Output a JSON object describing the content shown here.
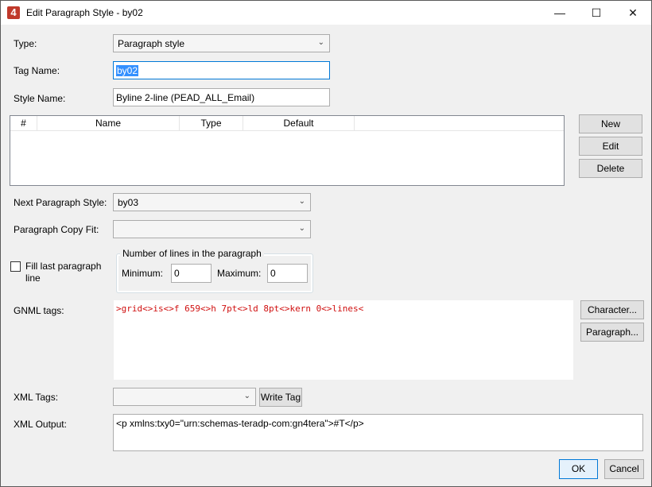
{
  "window": {
    "app_icon": "4",
    "title": "Edit Paragraph Style - by02",
    "minimize_glyph": "—",
    "maximize_glyph": "☐",
    "close_glyph": "✕"
  },
  "type": {
    "label": "Type:",
    "value": "Paragraph style"
  },
  "tag_name": {
    "label": "Tag Name:",
    "value": "by02"
  },
  "style_name": {
    "label": "Style Name:",
    "value": "Byline 2-line (PEAD_ALL_Email)"
  },
  "table": {
    "columns": [
      "#",
      "Name",
      "Type",
      "Default"
    ],
    "rows": []
  },
  "side_buttons": {
    "new": "New",
    "edit": "Edit",
    "delete": "Delete"
  },
  "next_style": {
    "label": "Next Paragraph Style:",
    "value": "by03"
  },
  "copy_fit": {
    "label": "Paragraph Copy Fit:",
    "value": ""
  },
  "fill_last": {
    "label_line1": "Fill last paragraph",
    "label_line2": "line",
    "checked": false
  },
  "lines_group": {
    "legend": "Number of lines in the paragraph",
    "minimum_label": "Minimum:",
    "minimum_value": "0",
    "maximum_label": "Maximum:",
    "maximum_value": "0"
  },
  "gnml": {
    "label": "GNML tags:",
    "value": ">grid<>is<>f 659<>h 7pt<>ld 8pt<>kern 0<>lines<",
    "text_color": "#d01010",
    "character_button": "Character...",
    "paragraph_button": "Paragraph..."
  },
  "xml_tags": {
    "label": "XML Tags:",
    "value": "",
    "write_button": "Write Tag"
  },
  "xml_output": {
    "label": "XML Output:",
    "value": "<p xmlns:txy0=\"urn:schemas-teradp-com:gn4tera\">#T</p>"
  },
  "footer": {
    "ok": "OK",
    "cancel": "Cancel"
  }
}
